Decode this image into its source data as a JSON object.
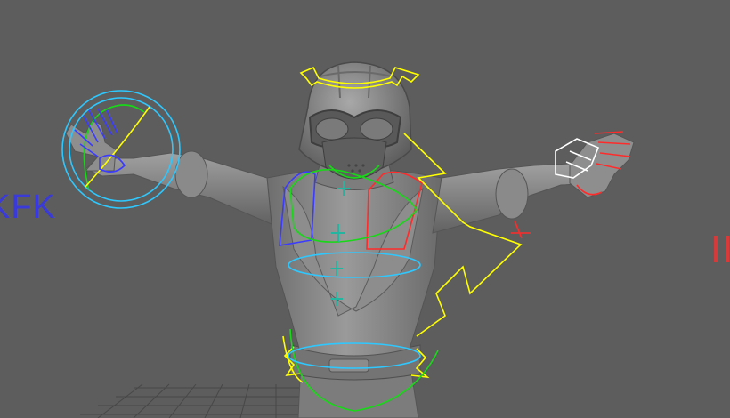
{
  "viewport": {
    "background": "#5d5d5d",
    "grid_color": "#474747"
  },
  "character": {
    "body_color": "#8a8a8a",
    "shadow_color": "#5f5f5f",
    "highlight_color": "#a4a4a4"
  },
  "rig_colors": {
    "left_side": "#3b3bff",
    "right_side": "#ff2b2b",
    "center": "#ffff00",
    "fk_green": "#18d818",
    "ik_cyan": "#2ec8ff",
    "pivot_teal": "#23b5a0",
    "selected_white": "#ffffff"
  },
  "labels": {
    "left_switch": "KFK",
    "right_switch": "II"
  },
  "icons": [
    "head-crown-control-icon",
    "pivot-cross-icon",
    "hand-control-icon",
    "hip-arrow-icon"
  ]
}
